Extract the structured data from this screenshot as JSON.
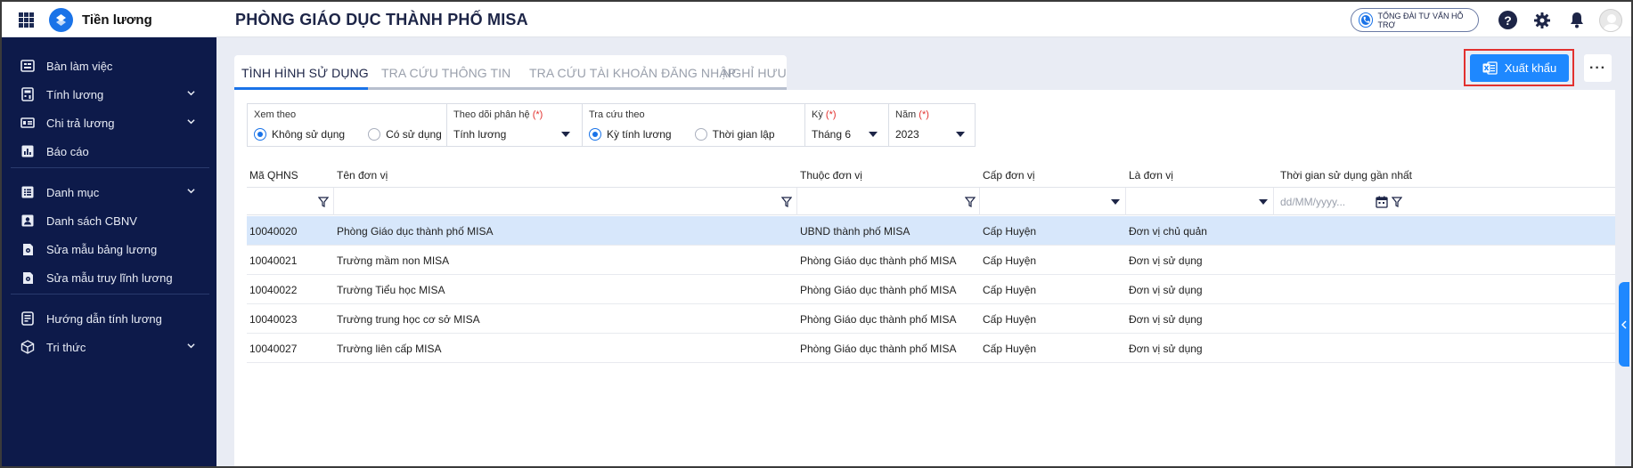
{
  "app": {
    "name": "Tiền lương",
    "org_title": "PHÒNG GIÁO DỤC THÀNH PHỐ MISA"
  },
  "topbar": {
    "hotline_label": "TỔNG ĐÀI TƯ VẤN HỖ TRỢ",
    "help_glyph": "?"
  },
  "sidebar": {
    "items": [
      {
        "label": "Bàn làm việc",
        "icon": "desktop-icon",
        "has_chevron": false
      },
      {
        "label": "Tính lương",
        "icon": "calculator-icon",
        "has_chevron": true
      },
      {
        "label": "Chi trả lương",
        "icon": "money-icon",
        "has_chevron": true
      },
      {
        "label": "Báo cáo",
        "icon": "report-icon",
        "has_chevron": false
      },
      {
        "label": "Danh mục",
        "icon": "list-icon",
        "has_chevron": true
      },
      {
        "label": "Danh sách CBNV",
        "icon": "employee-card-icon",
        "has_chevron": false
      },
      {
        "label": "Sửa mẫu bảng lương",
        "icon": "template-icon",
        "has_chevron": false
      },
      {
        "label": "Sửa mẫu truy lĩnh lương",
        "icon": "template-icon",
        "has_chevron": false
      },
      {
        "label": "Hướng dẫn tính lương",
        "icon": "guide-icon",
        "has_chevron": false
      },
      {
        "label": "Tri thức",
        "icon": "cube-icon",
        "has_chevron": true
      }
    ]
  },
  "tabs": [
    {
      "label": "TÌNH HÌNH SỬ DỤNG",
      "active": true
    },
    {
      "label": "TRA CỨU THÔNG TIN",
      "active": false
    },
    {
      "label": "TRA CỨU TÀI KHOẢN ĐĂNG NHẬP",
      "active": false
    },
    {
      "label": "NGHỈ HƯU",
      "active": false
    }
  ],
  "toolbar": {
    "export_label": "Xuất khẩu",
    "more_label": "···"
  },
  "filters": {
    "view_by": {
      "label": "Xem theo",
      "options": [
        "Không sử dụng",
        "Có sử dụng"
      ],
      "selected": 0
    },
    "module": {
      "label": "Theo dõi phân hệ",
      "required": "(*)",
      "value": "Tính lương"
    },
    "lookup_by": {
      "label": "Tra cứu theo",
      "options": [
        "Kỳ tính lương",
        "Thời gian lập"
      ],
      "selected": 0
    },
    "period": {
      "label": "Kỳ",
      "required": "(*)",
      "value": "Tháng 6"
    },
    "year": {
      "label": "Năm",
      "required": "(*)",
      "value": "2023"
    }
  },
  "table": {
    "columns": [
      "Mã QHNS",
      "Tên đơn vị",
      "Thuộc đơn vị",
      "Cấp đơn vị",
      "Là đơn vị",
      "Thời gian sử dụng gần nhất"
    ],
    "date_placeholder": "dd/MM/yyyy...",
    "rows": [
      [
        "10040020",
        "Phòng Giáo dục thành phố MISA",
        "UBND thành phố MISA",
        "Cấp Huyện",
        "Đơn vị chủ quản",
        ""
      ],
      [
        "10040021",
        "Trường mầm non MISA",
        "Phòng Giáo dục thành phố MISA",
        "Cấp Huyện",
        "Đơn vị sử dụng",
        ""
      ],
      [
        "10040022",
        "Trường Tiểu học MISA",
        "Phòng Giáo dục thành phố MISA",
        "Cấp Huyện",
        "Đơn vị sử dụng",
        ""
      ],
      [
        "10040023",
        "Trường trung học cơ sở MISA",
        "Phòng Giáo dục thành phố MISA",
        "Cấp Huyện",
        "Đơn vị sử dụng",
        ""
      ],
      [
        "10040027",
        "Trường liên cấp MISA",
        "Phòng Giáo dục thành phố MISA",
        "Cấp Huyện",
        "Đơn vị sử dụng",
        ""
      ]
    ],
    "selected_row": 0
  },
  "colors": {
    "sidebar_bg": "#0d1a4a",
    "accent": "#1e88ff",
    "highlight_outline": "#e2312f",
    "selected_row": "#d7e7fb"
  }
}
